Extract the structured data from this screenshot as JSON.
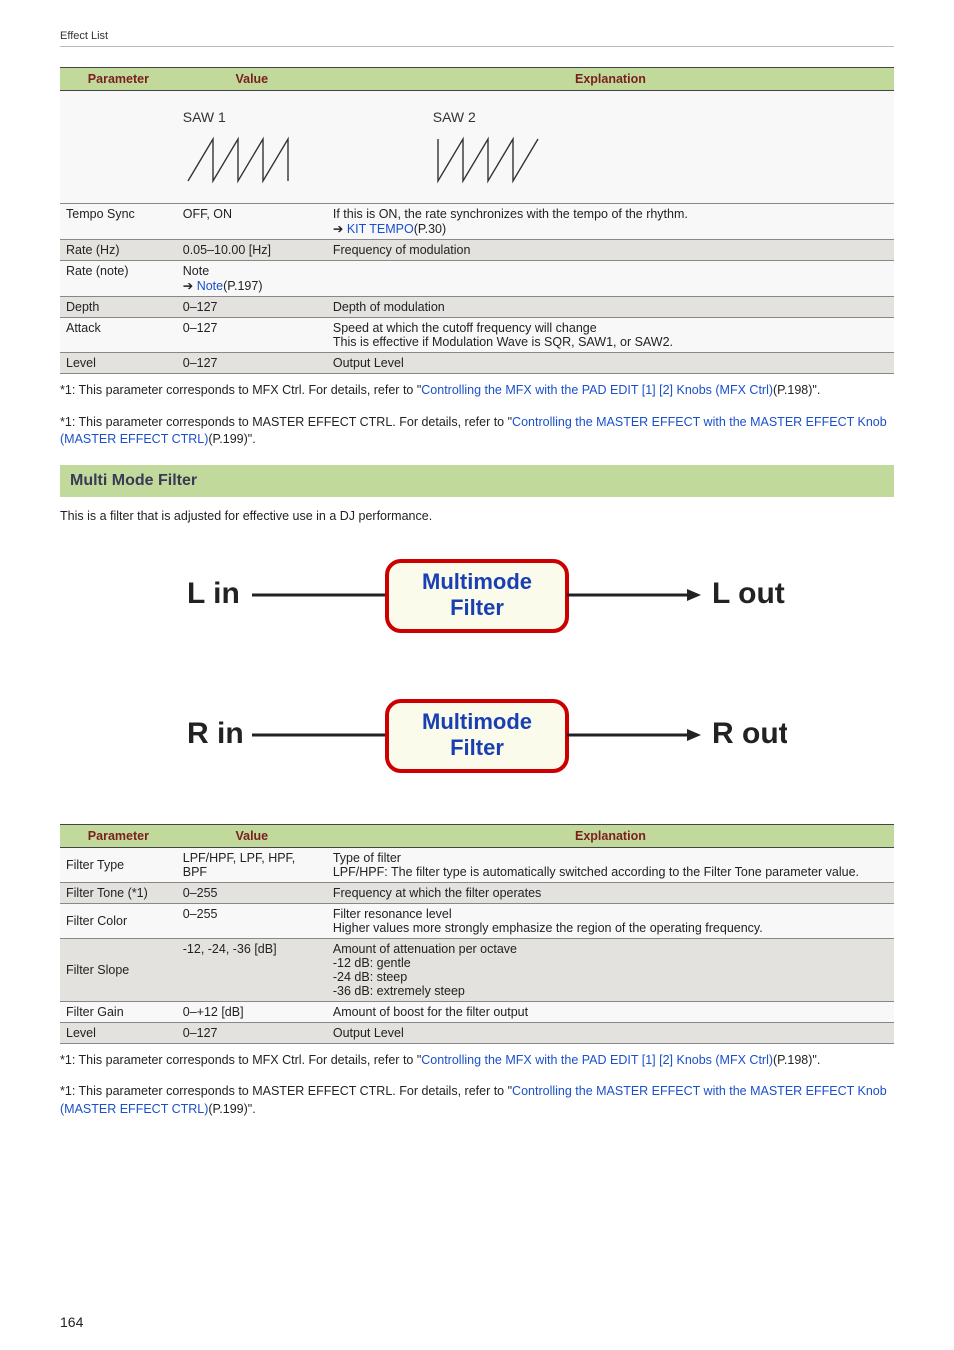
{
  "breadcrumb": "Effect List",
  "page_number": "164",
  "table1": {
    "headers": {
      "param": "Parameter",
      "value": "Value",
      "exp": "Explanation"
    },
    "wave_labels": {
      "saw1": "SAW 1",
      "saw2": "SAW 2"
    },
    "rows": [
      {
        "param": "Tempo Sync",
        "value": "OFF, ON",
        "exp_pre": "If this is ON, the rate synchronizes with the tempo of the rhythm.",
        "link": "KIT TEMPO",
        "link_page": "(P.30)"
      },
      {
        "param": "Rate (Hz)",
        "value": "0.05–10.00 [Hz]",
        "exp": "Frequency of modulation"
      },
      {
        "param": "Rate (note)",
        "value_pre": "Note",
        "value_link": "Note",
        "value_link_page": "(P.197)",
        "exp": ""
      },
      {
        "param": "Depth",
        "value": "0–127",
        "exp": "Depth of modulation"
      },
      {
        "param": "Attack",
        "value": "0–127",
        "exp_l1": "Speed at which the cutoff frequency will change",
        "exp_l2": "This is effective if Modulation Wave is SQR, SAW1, or SAW2."
      },
      {
        "param": "Level",
        "value": "0–127",
        "exp": "Output Level"
      }
    ]
  },
  "footnotes": {
    "f1_pre": "*1: This parameter corresponds to MFX Ctrl. For details, refer to \"",
    "f1_link": "Controlling the MFX with the PAD EDIT [1] [2] Knobs (MFX Ctrl)",
    "f1_post": "(P.198)\".",
    "f2_pre": "*1: This parameter corresponds to MASTER EFFECT CTRL. For details, refer to \"",
    "f2_link": "Controlling the MASTER EFFECT with the MASTER EFFECT Knob (MASTER EFFECT CTRL)",
    "f2_post": "(P.199)\"."
  },
  "section": {
    "title": "Multi Mode Filter",
    "desc": "This is a filter that is adjusted for effective use in a DJ performance.",
    "diagram": {
      "lin": "L in",
      "lout": "L out",
      "rin": "R in",
      "rout": "R out",
      "box": "Multimode\nFilter"
    }
  },
  "table2": {
    "headers": {
      "param": "Parameter",
      "value": "Value",
      "exp": "Explanation"
    },
    "rows": [
      {
        "param": "Filter Type",
        "value": "LPF/HPF, LPF, HPF, BPF",
        "exp_l1": "Type of filter",
        "exp_l2": "LPF/HPF: The filter type is automatically switched according to the Filter Tone parameter value."
      },
      {
        "param": "Filter Tone (*1)",
        "value": "0–255",
        "exp": "Frequency at which the filter operates"
      },
      {
        "param": "Filter Color",
        "value": "0–255",
        "exp_l1": "Filter resonance level",
        "exp_l2": "Higher values more strongly emphasize the region of the operating frequency."
      },
      {
        "param": "Filter Slope",
        "value": "-12, -24, -36 [dB]",
        "exp_l1": "Amount of attenuation per octave",
        "exp_l2": "-12 dB: gentle",
        "exp_l3": "-24 dB: steep",
        "exp_l4": "-36 dB: extremely steep"
      },
      {
        "param": "Filter Gain",
        "value": "0–+12 [dB]",
        "exp": "Amount of boost for the filter output"
      },
      {
        "param": "Level",
        "value": "0–127",
        "exp": "Output Level"
      }
    ]
  }
}
